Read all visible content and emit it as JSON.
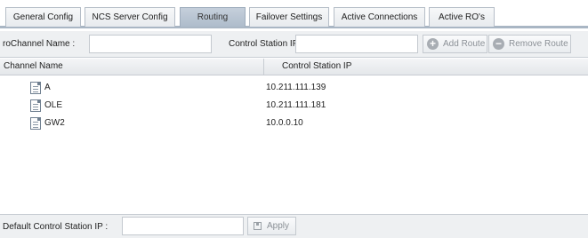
{
  "tabs": [
    {
      "label": "General Config",
      "active": false
    },
    {
      "label": "NCS Server Config",
      "active": false
    },
    {
      "label": "Routing",
      "active": true
    },
    {
      "label": "Failover Settings",
      "active": false
    },
    {
      "label": "Active Connections",
      "active": false
    },
    {
      "label": "Active RO's",
      "active": false
    }
  ],
  "toolbar": {
    "channel_name_label": "roChannel Name :",
    "channel_name_value": "",
    "control_station_label": "Control Station IP :",
    "control_station_value": "",
    "add_route_label": "Add Route",
    "add_route_icon": "plus-circle-icon",
    "remove_route_label": "Remove Route",
    "remove_route_icon": "minus-circle-icon"
  },
  "grid": {
    "columns": [
      "Channel Name",
      "Control Station IP"
    ],
    "rows": [
      {
        "name": "A",
        "ip": "10.211.111.139",
        "icon": "document-icon"
      },
      {
        "name": "OLE",
        "ip": "10.211.111.181",
        "icon": "document-icon"
      },
      {
        "name": "GW2",
        "ip": "10.0.0.10",
        "icon": "document-icon"
      }
    ]
  },
  "footer": {
    "default_ip_label": "Default Control Station IP :",
    "default_ip_value": "",
    "apply_label": "Apply",
    "apply_icon": "save-icon"
  }
}
